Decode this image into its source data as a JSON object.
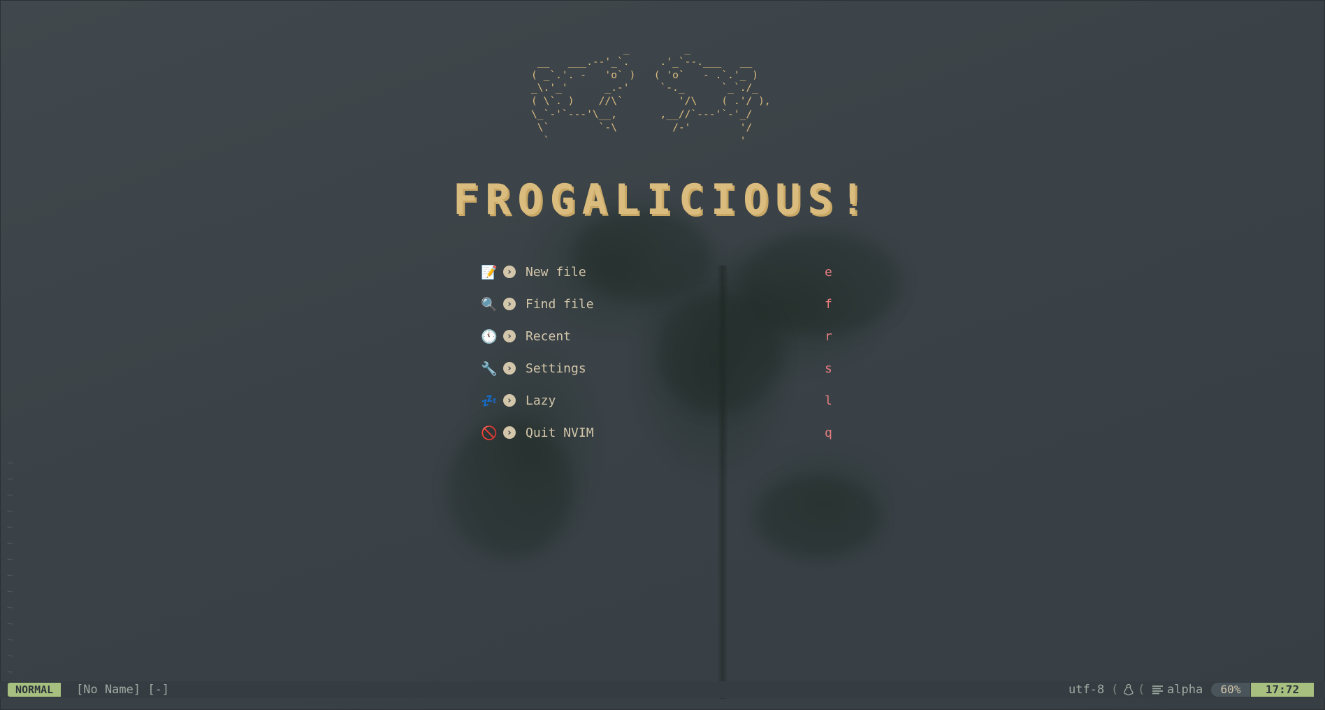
{
  "ascii_art": "               _         _\n __   ___.--'_`.     .'_`--.___   __\n( _`.'. -   'o` )   ( 'o`   - .`.'_ )\n_\\.'_'      _.-'     `-._      `_`./_\n( \\`. )    //\\`         '/\\    ( .'/ ),\n\\_`-'`---'\\__,       ,__//`---'`-'_/\n \\`        `-\\         /-'        '/\n  `                               '",
  "logo_title": "FROGALICIOUS!",
  "menu": [
    {
      "icon": "memo-icon",
      "emoji": "📝",
      "label": "New file",
      "key": "e"
    },
    {
      "icon": "magnifier-icon",
      "emoji": "🔍",
      "label": "Find file",
      "key": "f"
    },
    {
      "icon": "clock-icon",
      "emoji": "🕚",
      "label": "Recent",
      "key": "r"
    },
    {
      "icon": "wrench-icon",
      "emoji": "🔧",
      "label": "Settings",
      "key": "s"
    },
    {
      "icon": "zzz-icon",
      "emoji": "💤",
      "label": "Lazy",
      "key": "l"
    },
    {
      "icon": "prohibited-icon",
      "emoji": "🚫",
      "label": "Quit NVIM",
      "key": "q"
    }
  ],
  "tildes": "~\n~\n~\n~\n~\n~\n~\n~\n~\n~\n~\n~\n~\n~",
  "statusline": {
    "mode": "NORMAL",
    "filename": "[No Name] [-]",
    "encoding": "utf-8",
    "os_icon": "tux-icon",
    "filetype_icon": "lines-icon",
    "filetype": "alpha",
    "percent": "60%",
    "position": "17:72"
  },
  "colors": {
    "accent": "#a7c080",
    "logo": "#dbbc7f",
    "key": "#e67e80",
    "text": "#d3c6aa",
    "background": "#3a4248"
  }
}
